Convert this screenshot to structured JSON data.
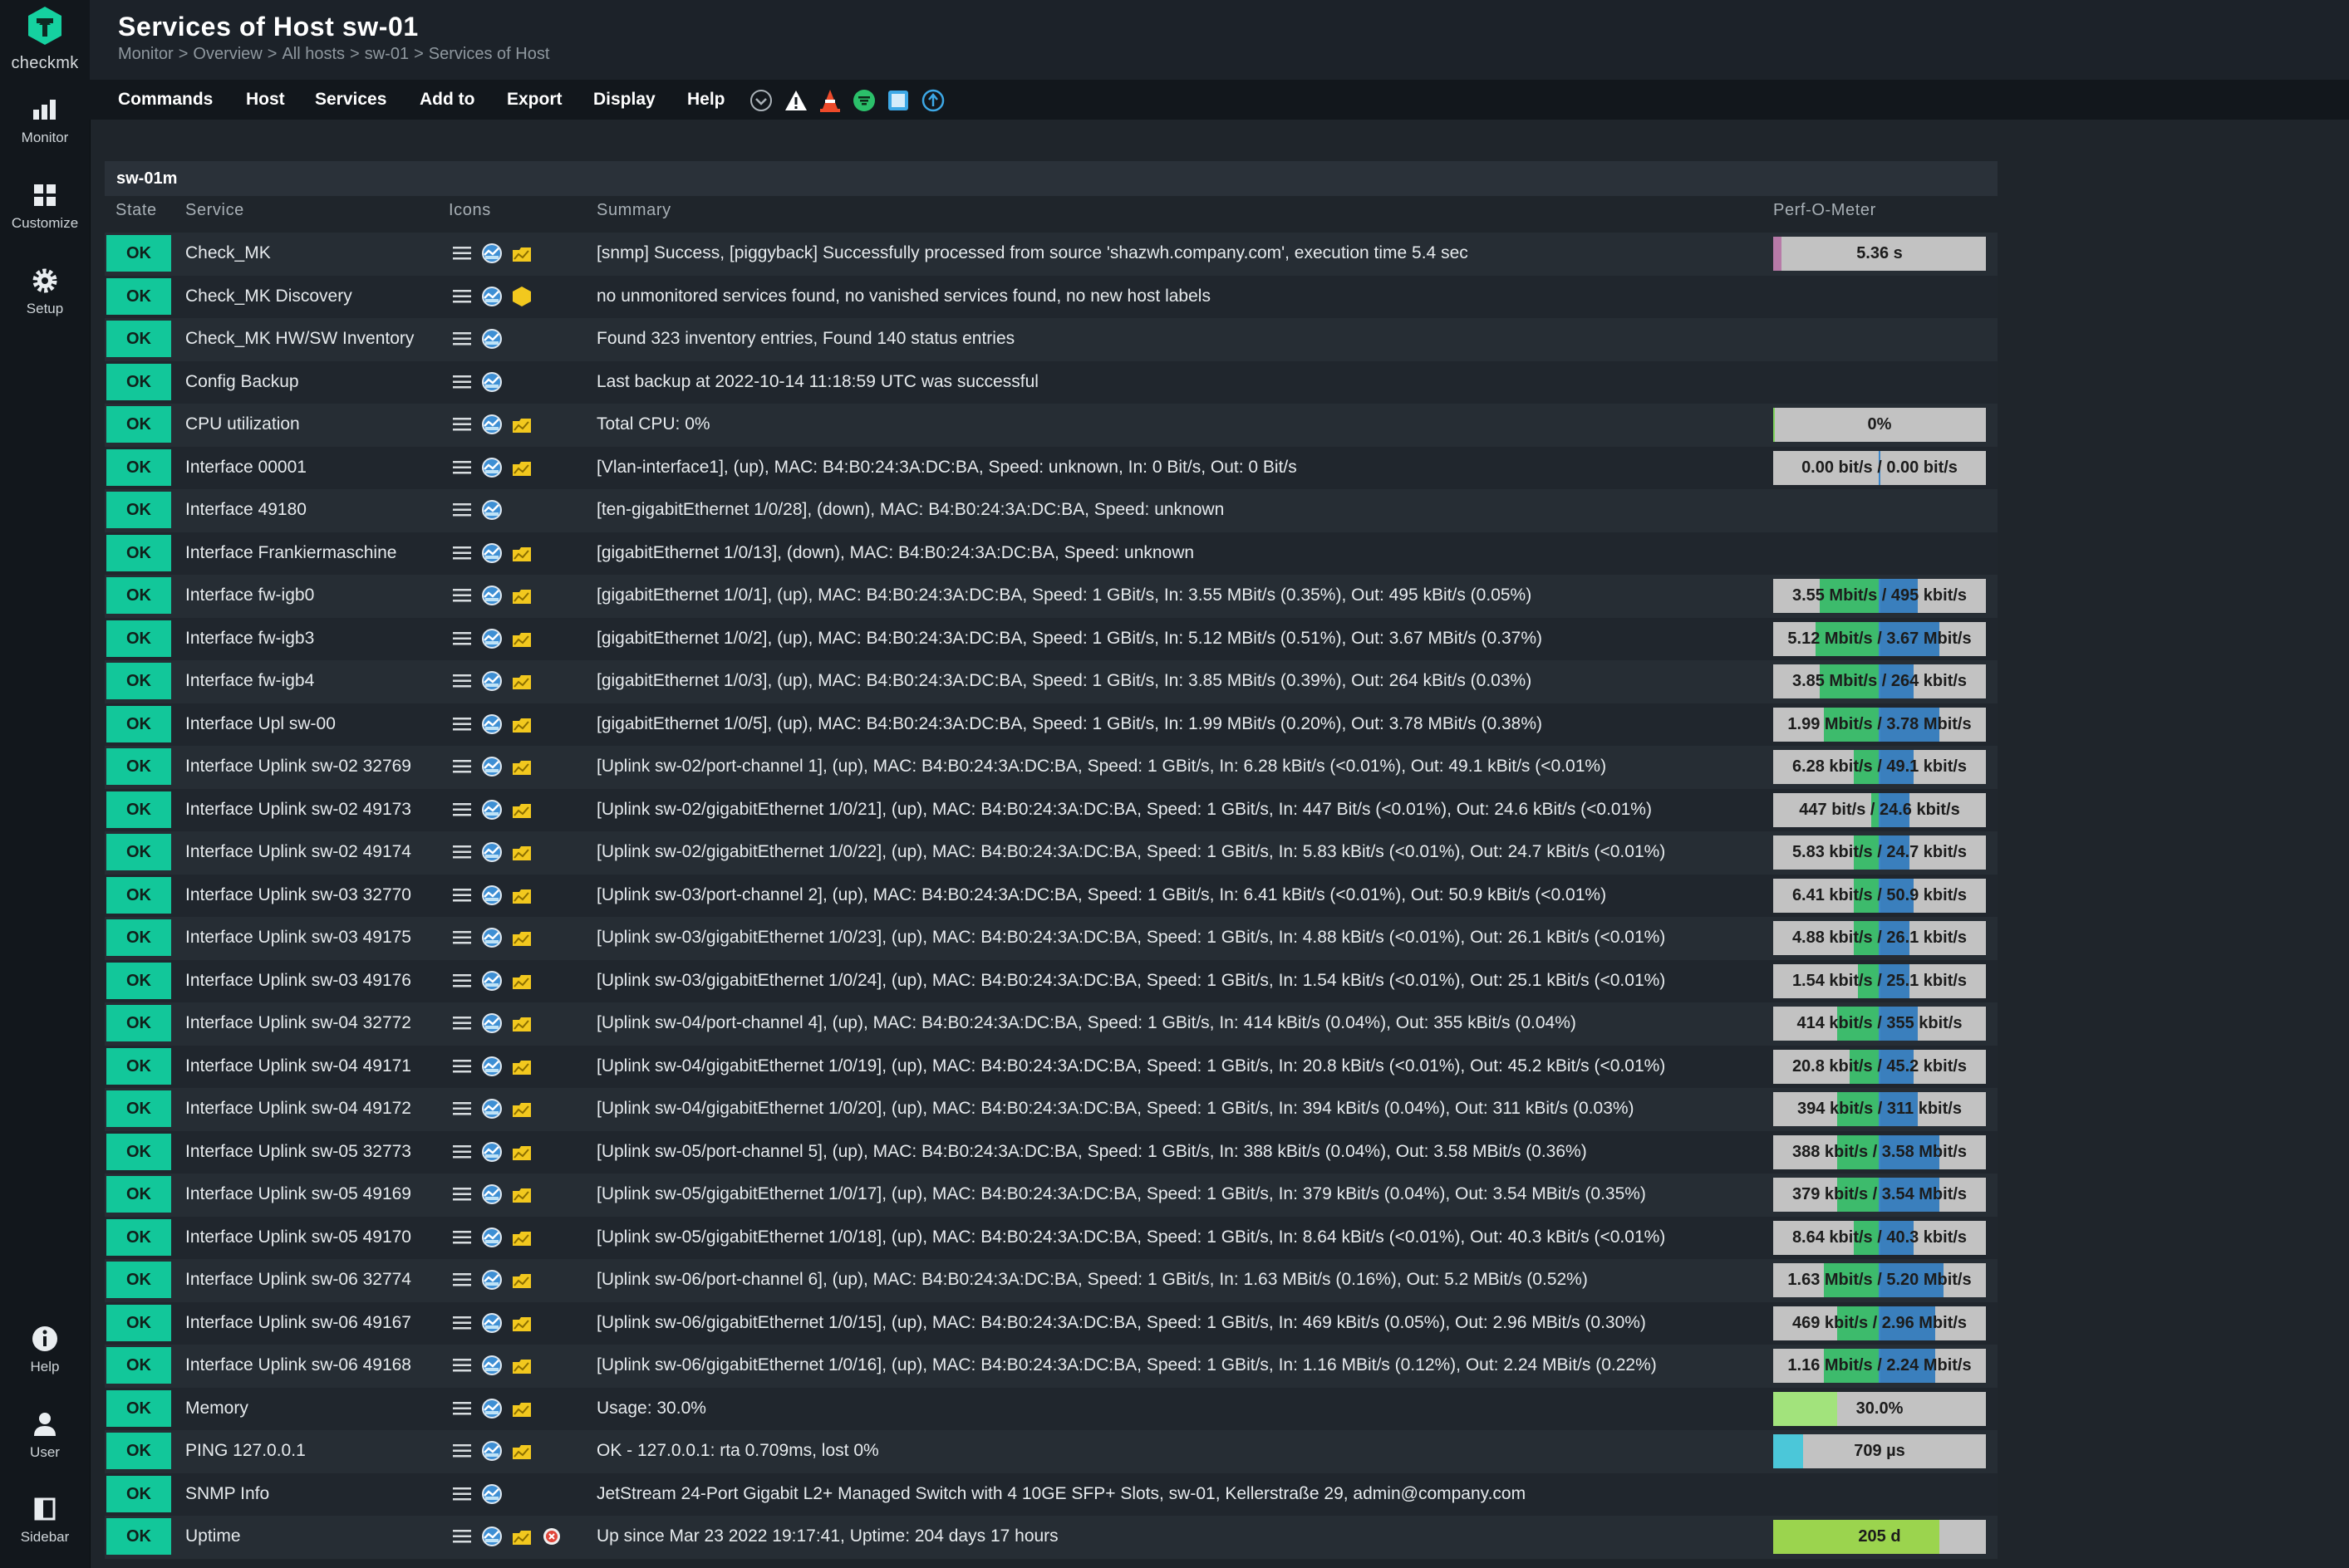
{
  "app": {
    "logo_text": "checkmk"
  },
  "sidebar_nav": [
    {
      "label": "Monitor",
      "icon": "bar-chart-icon"
    },
    {
      "label": "Customize",
      "icon": "grid-icon"
    },
    {
      "label": "Setup",
      "icon": "gear-icon"
    },
    {
      "label": "Help",
      "icon": "info-icon"
    },
    {
      "label": "User",
      "icon": "user-icon"
    },
    {
      "label": "Sidebar",
      "icon": "sidebar-icon"
    }
  ],
  "header": {
    "title": "Services of Host sw-01",
    "breadcrumb": [
      "Monitor",
      "Overview",
      "All hosts",
      "sw-01",
      "Services of Host"
    ],
    "breadcrumb_separator": ">"
  },
  "menu": [
    "Commands",
    "Host",
    "Services",
    "Add to",
    "Export",
    "Display",
    "Help"
  ],
  "toolbar_icons": [
    "chevron-down-circle-icon",
    "warning-triangle-icon",
    "traffic-cone-icon",
    "filter-icon",
    "checkbox-icon",
    "upload-icon"
  ],
  "table": {
    "group_title": "sw-01m",
    "columns": {
      "state": "State",
      "service": "Service",
      "icons": "Icons",
      "summary": "Summary",
      "perf": "Perf-O-Meter"
    },
    "colors": {
      "ok": "#12c79a",
      "perf_bg": "#c2c2c2",
      "in_green": "#3dbb6c",
      "out_blue": "#3a7fbd"
    },
    "rows": [
      {
        "state": "OK",
        "service": "Check_MK",
        "icons": [
          "menu-icon",
          "graph-icon",
          "folder-icon"
        ],
        "summary": "[snmp] Success, [piggyback] Successfully processed from source 'shazwh.company.com', execution time 5.4 sec",
        "perf": {
          "type": "single",
          "text": "5.36 s",
          "value": 0.04,
          "color": "#b77aa8"
        }
      },
      {
        "state": "OK",
        "service": "Check_MK Discovery",
        "icons": [
          "menu-icon",
          "graph-icon",
          "hexagon-icon"
        ],
        "summary": "no unmonitored services found, no vanished services found, no new host labels",
        "perf": null
      },
      {
        "state": "OK",
        "service": "Check_MK HW/SW Inventory",
        "icons": [
          "menu-icon",
          "graph-icon"
        ],
        "summary": "Found 323 inventory entries, Found 140 status entries",
        "perf": null
      },
      {
        "state": "OK",
        "service": "Config Backup",
        "icons": [
          "menu-icon",
          "graph-icon"
        ],
        "summary": "Last backup at 2022-10-14 11:18:59 UTC was successful",
        "perf": null
      },
      {
        "state": "OK",
        "service": "CPU utilization",
        "icons": [
          "menu-icon",
          "graph-icon",
          "folder-icon"
        ],
        "summary": "Total CPU: 0%",
        "perf": {
          "type": "single",
          "text": "0%",
          "value": 0.0,
          "color": "#7fd25c"
        }
      },
      {
        "state": "OK",
        "service": "Interface 00001",
        "icons": [
          "menu-icon",
          "graph-icon",
          "folder-icon"
        ],
        "summary": "[Vlan-interface1], (up), MAC: B4:B0:24:3A:DC:BA, Speed: unknown, In: 0 Bit/s, Out: 0 Bit/s",
        "perf": {
          "type": "dual",
          "text": "0.00 bit/s / 0.00 bit/s",
          "in": 0.0,
          "out": 0.0
        }
      },
      {
        "state": "OK",
        "service": "Interface 49180",
        "icons": [
          "menu-icon",
          "graph-icon"
        ],
        "summary": "[ten-gigabitEthernet 1/0/28], (down), MAC: B4:B0:24:3A:DC:BA, Speed: unknown",
        "perf": null
      },
      {
        "state": "OK",
        "service": "Interface Frankiermaschine",
        "icons": [
          "menu-icon",
          "graph-icon",
          "folder-icon"
        ],
        "summary": "[gigabitEthernet 1/0/13], (down), MAC: B4:B0:24:3A:DC:BA, Speed: unknown",
        "perf": null
      },
      {
        "state": "OK",
        "service": "Interface fw-igb0",
        "icons": [
          "menu-icon",
          "graph-icon",
          "folder-icon"
        ],
        "summary": "[gigabitEthernet 1/0/1], (up), MAC: B4:B0:24:3A:DC:BA, Speed: 1 GBit/s, In: 3.55 MBit/s (0.35%), Out: 495 kBit/s (0.05%)",
        "perf": {
          "type": "dual",
          "text": "3.55 Mbit/s / 495 kbit/s",
          "in": 0.28,
          "out": 0.18
        }
      },
      {
        "state": "OK",
        "service": "Interface fw-igb3",
        "icons": [
          "menu-icon",
          "graph-icon",
          "folder-icon"
        ],
        "summary": "[gigabitEthernet 1/0/2], (up), MAC: B4:B0:24:3A:DC:BA, Speed: 1 GBit/s, In: 5.12 MBit/s (0.51%), Out: 3.67 MBit/s (0.37%)",
        "perf": {
          "type": "dual",
          "text": "5.12 Mbit/s / 3.67 Mbit/s",
          "in": 0.3,
          "out": 0.28
        }
      },
      {
        "state": "OK",
        "service": "Interface fw-igb4",
        "icons": [
          "menu-icon",
          "graph-icon",
          "folder-icon"
        ],
        "summary": "[gigabitEthernet 1/0/3], (up), MAC: B4:B0:24:3A:DC:BA, Speed: 1 GBit/s, In: 3.85 MBit/s (0.39%), Out: 264 kBit/s (0.03%)",
        "perf": {
          "type": "dual",
          "text": "3.85 Mbit/s / 264 kbit/s",
          "in": 0.28,
          "out": 0.16
        }
      },
      {
        "state": "OK",
        "service": "Interface Upl sw-00",
        "icons": [
          "menu-icon",
          "graph-icon",
          "folder-icon"
        ],
        "summary": "[gigabitEthernet 1/0/5], (up), MAC: B4:B0:24:3A:DC:BA, Speed: 1 GBit/s, In: 1.99 MBit/s (0.20%), Out: 3.78 MBit/s (0.38%)",
        "perf": {
          "type": "dual",
          "text": "1.99 Mbit/s / 3.78 Mbit/s",
          "in": 0.26,
          "out": 0.28
        }
      },
      {
        "state": "OK",
        "service": "Interface Uplink sw-02 32769",
        "icons": [
          "menu-icon",
          "graph-icon",
          "folder-icon"
        ],
        "summary": "[Uplink sw-02/port-channel 1], (up), MAC: B4:B0:24:3A:DC:BA, Speed: 1 GBit/s, In: 6.28 kBit/s (<0.01%), Out: 49.1 kBit/s (<0.01%)",
        "perf": {
          "type": "dual",
          "text": "6.28 kbit/s / 49.1 kbit/s",
          "in": 0.12,
          "out": 0.16
        }
      },
      {
        "state": "OK",
        "service": "Interface Uplink sw-02 49173",
        "icons": [
          "menu-icon",
          "graph-icon",
          "folder-icon"
        ],
        "summary": "[Uplink sw-02/gigabitEthernet 1/0/21], (up), MAC: B4:B0:24:3A:DC:BA, Speed: 1 GBit/s, In: 447 Bit/s (<0.01%), Out: 24.6 kBit/s (<0.01%)",
        "perf": {
          "type": "dual",
          "text": "447 bit/s / 24.6 kbit/s",
          "in": 0.04,
          "out": 0.14
        }
      },
      {
        "state": "OK",
        "service": "Interface Uplink sw-02 49174",
        "icons": [
          "menu-icon",
          "graph-icon",
          "folder-icon"
        ],
        "summary": "[Uplink sw-02/gigabitEthernet 1/0/22], (up), MAC: B4:B0:24:3A:DC:BA, Speed: 1 GBit/s, In: 5.83 kBit/s (<0.01%), Out: 24.7 kBit/s (<0.01%)",
        "perf": {
          "type": "dual",
          "text": "5.83 kbit/s / 24.7 kbit/s",
          "in": 0.12,
          "out": 0.14
        }
      },
      {
        "state": "OK",
        "service": "Interface Uplink sw-03 32770",
        "icons": [
          "menu-icon",
          "graph-icon",
          "folder-icon"
        ],
        "summary": "[Uplink sw-03/port-channel 2], (up), MAC: B4:B0:24:3A:DC:BA, Speed: 1 GBit/s, In: 6.41 kBit/s (<0.01%), Out: 50.9 kBit/s (<0.01%)",
        "perf": {
          "type": "dual",
          "text": "6.41 kbit/s / 50.9 kbit/s",
          "in": 0.12,
          "out": 0.16
        }
      },
      {
        "state": "OK",
        "service": "Interface Uplink sw-03 49175",
        "icons": [
          "menu-icon",
          "graph-icon",
          "folder-icon"
        ],
        "summary": "[Uplink sw-03/gigabitEthernet 1/0/23], (up), MAC: B4:B0:24:3A:DC:BA, Speed: 1 GBit/s, In: 4.88 kBit/s (<0.01%), Out: 26.1 kBit/s (<0.01%)",
        "perf": {
          "type": "dual",
          "text": "4.88 kbit/s / 26.1 kbit/s",
          "in": 0.12,
          "out": 0.14
        }
      },
      {
        "state": "OK",
        "service": "Interface Uplink sw-03 49176",
        "icons": [
          "menu-icon",
          "graph-icon",
          "folder-icon"
        ],
        "summary": "[Uplink sw-03/gigabitEthernet 1/0/24], (up), MAC: B4:B0:24:3A:DC:BA, Speed: 1 GBit/s, In: 1.54 kBit/s (<0.01%), Out: 25.1 kBit/s (<0.01%)",
        "perf": {
          "type": "dual",
          "text": "1.54 kbit/s / 25.1 kbit/s",
          "in": 0.1,
          "out": 0.14
        }
      },
      {
        "state": "OK",
        "service": "Interface Uplink sw-04 32772",
        "icons": [
          "menu-icon",
          "graph-icon",
          "folder-icon"
        ],
        "summary": "[Uplink sw-04/port-channel 4], (up), MAC: B4:B0:24:3A:DC:BA, Speed: 1 GBit/s, In: 414 kBit/s (0.04%), Out: 355 kBit/s (0.04%)",
        "perf": {
          "type": "dual",
          "text": "414 kbit/s / 355 kbit/s",
          "in": 0.2,
          "out": 0.18
        }
      },
      {
        "state": "OK",
        "service": "Interface Uplink sw-04 49171",
        "icons": [
          "menu-icon",
          "graph-icon",
          "folder-icon"
        ],
        "summary": "[Uplink sw-04/gigabitEthernet 1/0/19], (up), MAC: B4:B0:24:3A:DC:BA, Speed: 1 GBit/s, In: 20.8 kBit/s (<0.01%), Out: 45.2 kBit/s (<0.01%)",
        "perf": {
          "type": "dual",
          "text": "20.8 kbit/s / 45.2 kbit/s",
          "in": 0.14,
          "out": 0.16
        }
      },
      {
        "state": "OK",
        "service": "Interface Uplink sw-04 49172",
        "icons": [
          "menu-icon",
          "graph-icon",
          "folder-icon"
        ],
        "summary": "[Uplink sw-04/gigabitEthernet 1/0/20], (up), MAC: B4:B0:24:3A:DC:BA, Speed: 1 GBit/s, In: 394 kBit/s (0.04%), Out: 311 kBit/s (0.03%)",
        "perf": {
          "type": "dual",
          "text": "394 kbit/s / 311 kbit/s",
          "in": 0.2,
          "out": 0.18
        }
      },
      {
        "state": "OK",
        "service": "Interface Uplink sw-05 32773",
        "icons": [
          "menu-icon",
          "graph-icon",
          "folder-icon"
        ],
        "summary": "[Uplink sw-05/port-channel 5], (up), MAC: B4:B0:24:3A:DC:BA, Speed: 1 GBit/s, In: 388 kBit/s (0.04%), Out: 3.58 MBit/s (0.36%)",
        "perf": {
          "type": "dual",
          "text": "388 kbit/s / 3.58 Mbit/s",
          "in": 0.2,
          "out": 0.28
        }
      },
      {
        "state": "OK",
        "service": "Interface Uplink sw-05 49169",
        "icons": [
          "menu-icon",
          "graph-icon",
          "folder-icon"
        ],
        "summary": "[Uplink sw-05/gigabitEthernet 1/0/17], (up), MAC: B4:B0:24:3A:DC:BA, Speed: 1 GBit/s, In: 379 kBit/s (0.04%), Out: 3.54 MBit/s (0.35%)",
        "perf": {
          "type": "dual",
          "text": "379 kbit/s / 3.54 Mbit/s",
          "in": 0.2,
          "out": 0.28
        }
      },
      {
        "state": "OK",
        "service": "Interface Uplink sw-05 49170",
        "icons": [
          "menu-icon",
          "graph-icon",
          "folder-icon"
        ],
        "summary": "[Uplink sw-05/gigabitEthernet 1/0/18], (up), MAC: B4:B0:24:3A:DC:BA, Speed: 1 GBit/s, In: 8.64 kBit/s (<0.01%), Out: 40.3 kBit/s (<0.01%)",
        "perf": {
          "type": "dual",
          "text": "8.64 kbit/s / 40.3 kbit/s",
          "in": 0.12,
          "out": 0.16
        }
      },
      {
        "state": "OK",
        "service": "Interface Uplink sw-06 32774",
        "icons": [
          "menu-icon",
          "graph-icon",
          "folder-icon"
        ],
        "summary": "[Uplink sw-06/port-channel 6], (up), MAC: B4:B0:24:3A:DC:BA, Speed: 1 GBit/s, In: 1.63 MBit/s (0.16%), Out: 5.2 MBit/s (0.52%)",
        "perf": {
          "type": "dual",
          "text": "1.63 Mbit/s / 5.20 Mbit/s",
          "in": 0.26,
          "out": 0.3
        }
      },
      {
        "state": "OK",
        "service": "Interface Uplink sw-06 49167",
        "icons": [
          "menu-icon",
          "graph-icon",
          "folder-icon"
        ],
        "summary": "[Uplink sw-06/gigabitEthernet 1/0/15], (up), MAC: B4:B0:24:3A:DC:BA, Speed: 1 GBit/s, In: 469 kBit/s (0.05%), Out: 2.96 MBit/s (0.30%)",
        "perf": {
          "type": "dual",
          "text": "469 kbit/s / 2.96 Mbit/s",
          "in": 0.2,
          "out": 0.26
        }
      },
      {
        "state": "OK",
        "service": "Interface Uplink sw-06 49168",
        "icons": [
          "menu-icon",
          "graph-icon",
          "folder-icon"
        ],
        "summary": "[Uplink sw-06/gigabitEthernet 1/0/16], (up), MAC: B4:B0:24:3A:DC:BA, Speed: 1 GBit/s, In: 1.16 MBit/s (0.12%), Out: 2.24 MBit/s (0.22%)",
        "perf": {
          "type": "dual",
          "text": "1.16 Mbit/s / 2.24 Mbit/s",
          "in": 0.26,
          "out": 0.26
        }
      },
      {
        "state": "OK",
        "service": "Memory",
        "icons": [
          "menu-icon",
          "graph-icon",
          "folder-icon"
        ],
        "summary": "Usage: 30.0%",
        "perf": {
          "type": "single",
          "text": "30.0%",
          "value": 0.3,
          "color": "#a2e37c"
        }
      },
      {
        "state": "OK",
        "service": "PING 127.0.0.1",
        "icons": [
          "menu-icon",
          "graph-icon",
          "folder-icon"
        ],
        "summary": "OK - 127.0.0.1: rta 0.709ms, lost 0%",
        "perf": {
          "type": "single",
          "text": "709 µs",
          "value": 0.14,
          "color": "#4bc7d9"
        }
      },
      {
        "state": "OK",
        "service": "SNMP Info",
        "icons": [
          "menu-icon",
          "graph-icon"
        ],
        "summary": "JetStream 24-Port Gigabit L2+ Managed Switch with 4 10GE SFP+ Slots, sw-01, Kellerstraße 29, admin@company.com",
        "perf": null
      },
      {
        "state": "OK",
        "service": "Uptime",
        "icons": [
          "menu-icon",
          "graph-icon",
          "folder-icon",
          "alert-badge-icon"
        ],
        "summary": "Up since Mar 23 2022 19:17:41, Uptime: 204 days 17 hours",
        "perf": {
          "type": "single",
          "text": "205 d",
          "value": 0.78,
          "color": "#9bd44e"
        }
      }
    ]
  }
}
